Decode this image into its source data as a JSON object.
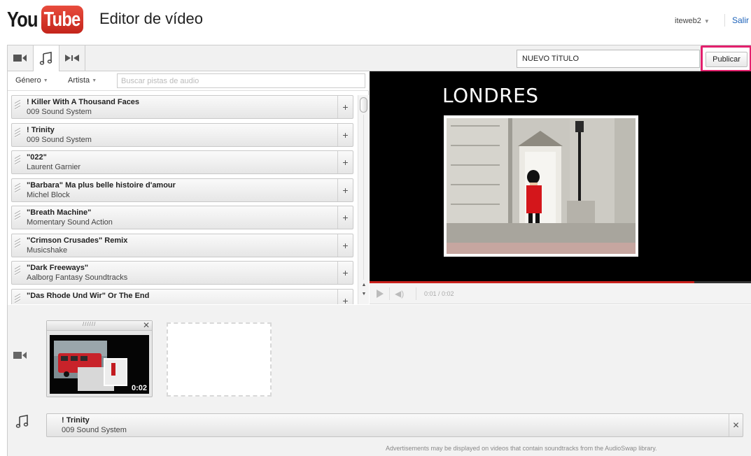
{
  "header": {
    "logo_you": "You",
    "logo_tube": "Tube",
    "title": "Editor de vídeo",
    "username": "iteweb2",
    "signout_label": "Salir"
  },
  "toolbar": {
    "tabs": [
      {
        "name": "video",
        "icon": "video-camera-icon",
        "active": false
      },
      {
        "name": "audio",
        "icon": "music-note-icon",
        "active": true
      },
      {
        "name": "transitions",
        "icon": "transition-icon",
        "active": false
      }
    ],
    "title_value": "NUEVO TÍTULO",
    "publish_label": "Publicar"
  },
  "library": {
    "genre_label": "Género",
    "artist_label": "Artista",
    "search_placeholder": "Buscar pistas de audio",
    "tracks": [
      {
        "title": "! Killer With A Thousand Faces",
        "artist": "009 Sound System"
      },
      {
        "title": "! Trinity",
        "artist": "009 Sound System"
      },
      {
        "title": "\"022\"",
        "artist": "Laurent Garnier"
      },
      {
        "title": "\"Barbara\" Ma plus belle histoire d'amour",
        "artist": "Michel Block"
      },
      {
        "title": "\"Breath Machine\"",
        "artist": "Momentary Sound Action"
      },
      {
        "title": "\"Crimson Crusades\" Remix",
        "artist": "Musicshake"
      },
      {
        "title": "\"Dark Freeways\"",
        "artist": "Aalborg Fantasy Soundtracks"
      },
      {
        "title": "\"Das Rhode Und Wir\" Or The End",
        "artist": ""
      }
    ],
    "add_symbol": "+"
  },
  "player": {
    "slide_title": "LONDRES",
    "time": "0:01 / 0:02",
    "progress": 0.85
  },
  "timeline": {
    "clip_grip": "//////",
    "clip_close": "✕",
    "clip_duration": "0:02",
    "audio_track": {
      "title": "! Trinity",
      "artist": "009 Sound System"
    },
    "audio_remove": "✕",
    "disclaimer": "Advertisements may be displayed on videos that contain soundtracks from the AudioSwap library."
  },
  "colors": {
    "brand_red": "#c4251b",
    "publish_highlight": "#e3206d",
    "link_blue": "#1c62b9"
  }
}
